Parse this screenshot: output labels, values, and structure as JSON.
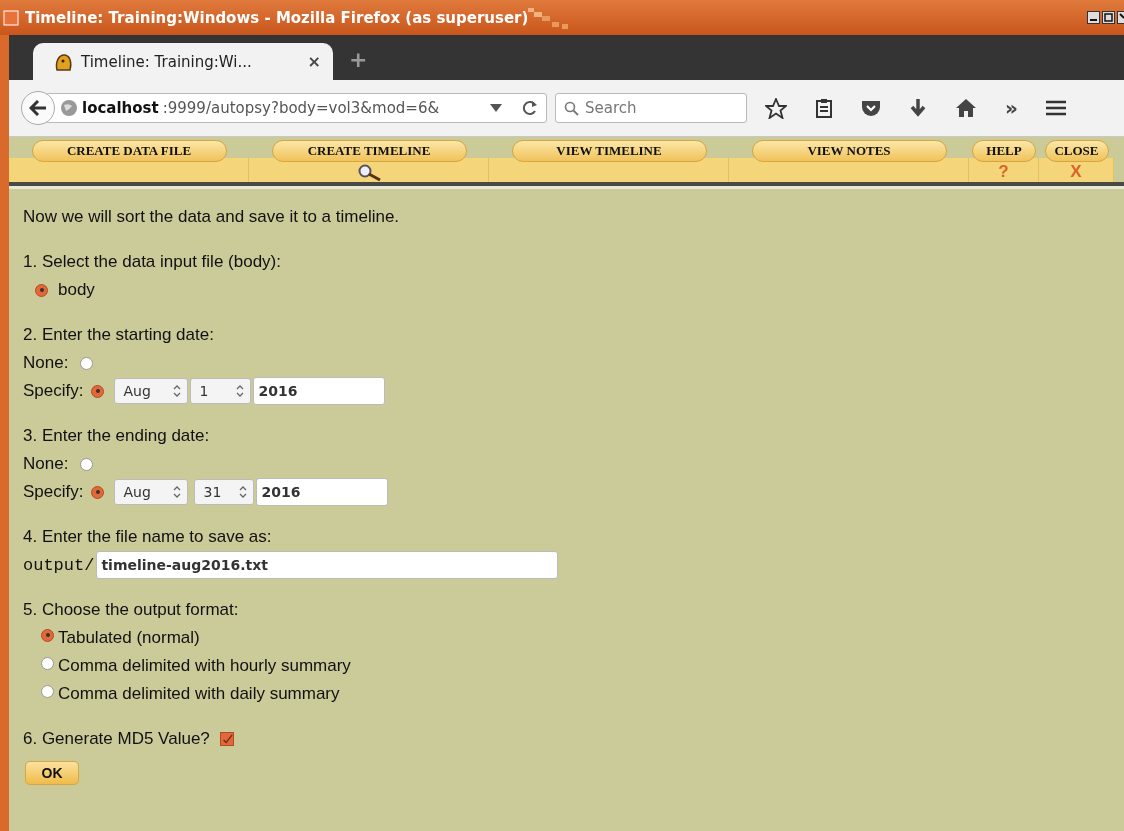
{
  "window": {
    "title": "Timeline: Training:Windows - Mozilla Firefox (as superuser)"
  },
  "tab": {
    "title": "Timeline: Training:Wi...",
    "close": "×",
    "new_tab": "+"
  },
  "toolbar": {
    "url_host": "localhost",
    "url_rest": ":9999/autopsy?body=vol3&mod=6&",
    "search_placeholder": "Search",
    "overflow": "»"
  },
  "nav": [
    {
      "label": "CREATE DATA FILE",
      "kind": "plain"
    },
    {
      "label": "CREATE TIMELINE",
      "kind": "search"
    },
    {
      "label": "VIEW TIMELINE",
      "kind": "plain"
    },
    {
      "label": "VIEW NOTES",
      "kind": "plain"
    },
    {
      "label": "HELP",
      "kind": "glyph",
      "glyph": "?"
    },
    {
      "label": "CLOSE",
      "kind": "glyph",
      "glyph": "X"
    }
  ],
  "form": {
    "intro": "Now we will sort the data and save it to a timeline.",
    "step1": {
      "label": "1. Select the data input file (body):",
      "options": [
        {
          "label": "body",
          "selected": true
        }
      ]
    },
    "start": {
      "label": "2. Enter the starting date:",
      "none_label": "None:",
      "none_selected": false,
      "specify_label": "Specify:",
      "specify_selected": true,
      "month": "Aug",
      "day": "1",
      "year": "2016"
    },
    "end": {
      "label": "3. Enter the ending date:",
      "none_label": "None:",
      "none_selected": false,
      "specify_label": "Specify:",
      "specify_selected": true,
      "month": "Aug",
      "day": "31",
      "year": "2016"
    },
    "file": {
      "label": "4. Enter the file name to save as:",
      "prefix": "output/",
      "value": "timeline-aug2016.txt"
    },
    "format": {
      "label": "5. Choose the output format:",
      "options": [
        {
          "label": "Tabulated (normal)",
          "selected": true
        },
        {
          "label": "Comma delimited with hourly summary",
          "selected": false
        },
        {
          "label": "Comma delimited with daily summary",
          "selected": false
        }
      ]
    },
    "md5": {
      "label": "6. Generate MD5 Value?",
      "checked": true
    },
    "ok_button": "OK"
  }
}
